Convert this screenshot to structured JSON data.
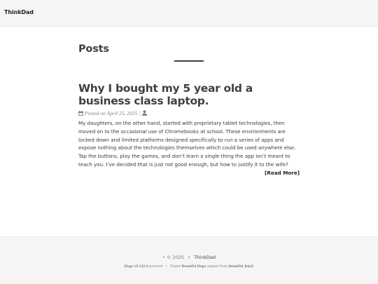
{
  "nav": {
    "brand": "ThinkDad"
  },
  "page": {
    "heading": "Posts"
  },
  "post": {
    "title": "Why I bought my 5 year old a business class laptop.",
    "meta_prefix": "Posted on",
    "date": "April 25, 2025",
    "separator": "|",
    "icons": [
      "calendar-icon",
      "user-icon"
    ],
    "excerpt": "My daughters, on the other hand, started with proprietary tablet technologies, then moved on to the occasional use of Chromebooks at school. These environments are locked down and limited platforms designed specifically to run a series of apps and expose nothing about the technologies themselves which could be used anywhere else. Tap the buttons, play the games, and don’t learn a single thing the app isn’t meant to teach you. I’ve decided that is just not good enough, but how to justify it to the wife?",
    "read_more": "[Read More]"
  },
  "footer": {
    "bullet": "•",
    "copyright": "© 2025",
    "author": "ThinkDad",
    "hugo_link": "Hugo v0.142.0",
    "powered": "powered",
    "theme_label": "Theme",
    "theme_link": "Beautiful Hugo",
    "adapted": "adapted from",
    "jekyll_link": "Beautiful Jekyll"
  }
}
